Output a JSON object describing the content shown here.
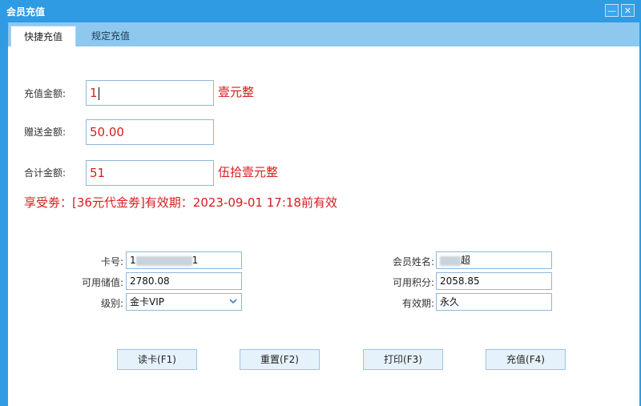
{
  "window": {
    "title": "会员充值",
    "minimize_symbol": "—",
    "close_symbol": "✕"
  },
  "tabs": [
    {
      "label": "快捷充值",
      "active": true
    },
    {
      "label": "规定充值",
      "active": false
    }
  ],
  "quick": {
    "recharge_label": "充值金额:",
    "recharge_value": "1",
    "recharge_words": "壹元整",
    "gift_label": "赠送金额:",
    "gift_value": "50.00",
    "total_label": "合计金额:",
    "total_value": "51",
    "total_words": "伍拾壹元整",
    "coupon_text": "享受劵：[36元代金劵]有效期：2023-09-01 17:18前有效"
  },
  "member": {
    "card_no_label": "卡号:",
    "card_no_prefix": "1",
    "card_no_suffix": "1",
    "balance_label": "可用储值:",
    "balance_value": "2780.08",
    "level_label": "级别:",
    "level_value": "金卡VIP",
    "name_label": "会员姓名:",
    "name_suffix": "超",
    "points_label": "可用积分:",
    "points_value": "2058.85",
    "expiry_label": "有效期:",
    "expiry_value": "永久"
  },
  "buttons": {
    "read_card": "读卡(F1)",
    "reset": "重置(F2)",
    "print": "打印(F3)",
    "recharge": "充值(F4)"
  },
  "colors": {
    "accent": "#2f9be3",
    "amount_red": "#d61d1d"
  }
}
